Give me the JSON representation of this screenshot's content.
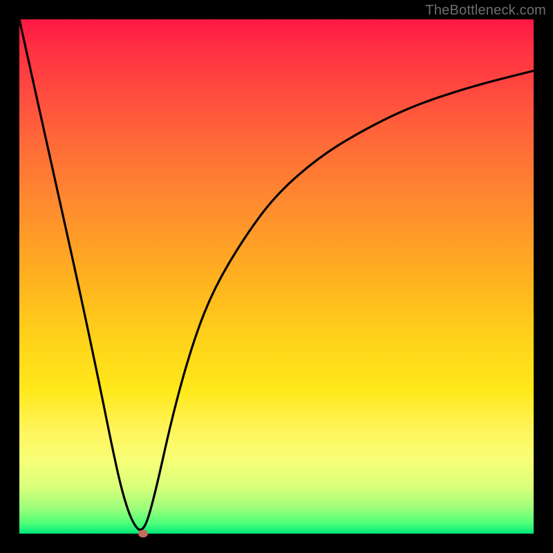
{
  "watermark": "TheBottleneck.com",
  "colors": {
    "frame": "#000000",
    "curve": "#000000",
    "marker": "#c56a5d",
    "watermark": "#6e6e6e",
    "gradient_stops": [
      "#ff1744",
      "#ff3142",
      "#ff4a3f",
      "#ff6a38",
      "#ff8b2f",
      "#ffb020",
      "#ffd21a",
      "#ffe81a",
      "#fff55c",
      "#f6ff78",
      "#d9ff7a",
      "#9eff7a",
      "#4eff79",
      "#00e77a"
    ]
  },
  "chart_data": {
    "type": "line",
    "title": "",
    "xlabel": "",
    "ylabel": "",
    "xlim": [
      0,
      100
    ],
    "ylim": [
      0,
      100
    ],
    "grid": false,
    "legend": false,
    "series": [
      {
        "name": "bottleneck-curve",
        "x": [
          0,
          4,
          8,
          12,
          16,
          18,
          20,
          22,
          24,
          26,
          30,
          34,
          38,
          44,
          50,
          58,
          66,
          76,
          88,
          100
        ],
        "y": [
          100,
          82,
          64,
          46,
          27,
          17,
          8,
          2,
          0,
          6,
          24,
          38,
          48,
          58,
          66,
          73,
          78,
          83,
          87,
          90
        ]
      }
    ],
    "marker": {
      "x": 24,
      "y": 0
    },
    "background_gradient": "red-to-green vertical"
  }
}
